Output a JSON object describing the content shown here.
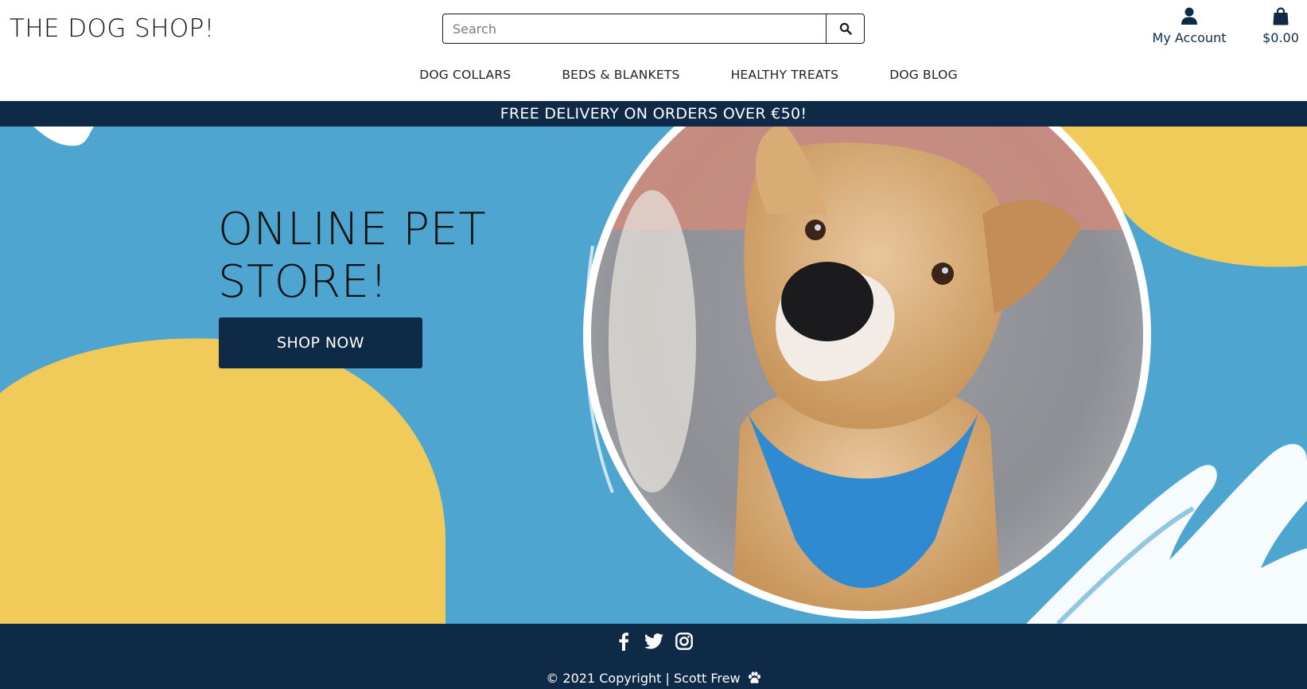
{
  "header": {
    "logo": "THE DOG SHOP!",
    "search": {
      "placeholder": "Search"
    },
    "account_label": "My Account",
    "cart_total": "$0.00"
  },
  "nav": {
    "items": [
      {
        "label": "DOG COLLARS"
      },
      {
        "label": "BEDS & BLANKETS"
      },
      {
        "label": "HEALTHY TREATS"
      },
      {
        "label": "DOG BLOG"
      }
    ]
  },
  "banner": {
    "text": "FREE DELIVERY ON ORDERS OVER €50!"
  },
  "hero": {
    "title_line1": "ONLINE PET",
    "title_line2": "STORE!",
    "cta_label": "SHOP NOW",
    "image_subject": "dog-photo"
  },
  "footer": {
    "socials": [
      "facebook-icon",
      "twitter-icon",
      "instagram-icon"
    ],
    "copyright": "© 2021 Copyright | Scott Frew"
  },
  "colors": {
    "navy": "#0e2a47",
    "hero_blue": "#4ea5cf",
    "accent_yellow": "#f0cb5a",
    "white": "#ffffff"
  }
}
